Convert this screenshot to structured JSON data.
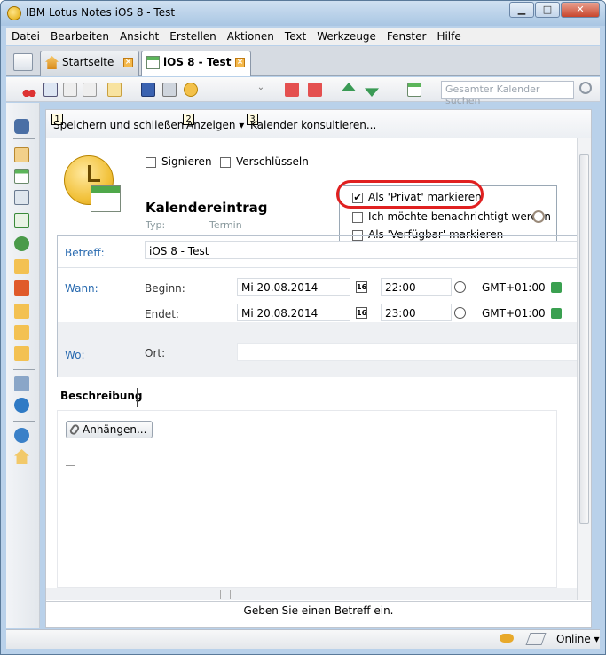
{
  "window": {
    "title": "IBM Lotus Notes iOS 8 - Test",
    "min_label": "▁",
    "max_label": "□",
    "close_label": "✕"
  },
  "menu": [
    "Datei",
    "Bearbeiten",
    "Ansicht",
    "Erstellen",
    "Aktionen",
    "Text",
    "Werkzeuge",
    "Fenster",
    "Hilfe"
  ],
  "tabs": [
    {
      "label": "Startseite"
    },
    {
      "label": "iOS 8 - Test"
    }
  ],
  "toolbar": {
    "search_placeholder": "Gesamter Kalender suchen"
  },
  "actions": [
    {
      "accel": "1",
      "label": "Speichern und schließen"
    },
    {
      "accel": "2",
      "label": "Anzeigen ▾"
    },
    {
      "accel": "3",
      "label": "Kalender konsultieren..."
    }
  ],
  "header": {
    "sign_label": "Signieren",
    "encrypt_label": "Verschlüsseln",
    "title": "Kalendereintrag",
    "type_label": "Typ:",
    "type_value": "Termin"
  },
  "options": {
    "private_label": "Als 'Privat' markieren",
    "private_checked": true,
    "notify_label": "Ich möchte benachrichtigt werden",
    "available_label": "Als 'Verfügbar' markieren"
  },
  "fields": {
    "subject_label": "Betreff:",
    "subject_value": "iOS 8 - Test",
    "when_label": "Wann:",
    "begin_label": "Beginn:",
    "end_label": "Endet:",
    "begin_date": "Mi 20.08.2014",
    "begin_time": "22:00",
    "end_date": "Mi 20.08.2014",
    "end_time": "23:00",
    "timezone": "GMT+01:00",
    "date_picker": "16",
    "where_label": "Wo:",
    "location_label": "Ort:"
  },
  "description": {
    "tab_label": "Beschreibung",
    "attach_label": "Anhängen..."
  },
  "hint": "Geben Sie einen Betreff ein.",
  "status": {
    "online_label": "Online ▾"
  },
  "colors": {
    "accent_blue": "#2a6bb0",
    "highlight_ring": "#e02020",
    "title_bar": "#b9d1ea"
  }
}
